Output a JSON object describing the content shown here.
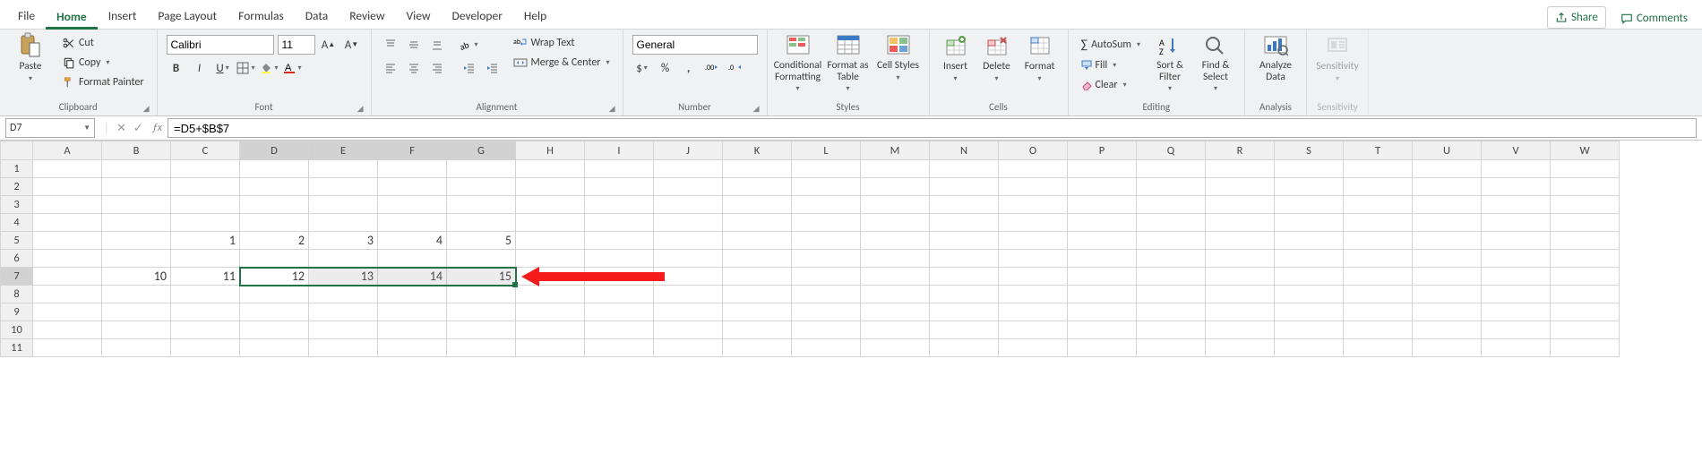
{
  "tabs": {
    "file": "File",
    "home": "Home",
    "insert": "Insert",
    "pagelayout": "Page Layout",
    "formulas": "Formulas",
    "data": "Data",
    "review": "Review",
    "view": "View",
    "developer": "Developer",
    "help": "Help"
  },
  "top_right": {
    "share": "Share",
    "comments": "Comments"
  },
  "ribbon": {
    "clipboard": {
      "paste": "Paste",
      "cut": "Cut",
      "copy": "Copy",
      "fmtpainter": "Format Painter",
      "label": "Clipboard"
    },
    "font": {
      "name": "Calibri",
      "size": "11",
      "label": "Font"
    },
    "alignment": {
      "wrap": "Wrap Text",
      "merge": "Merge & Center",
      "label": "Alignment"
    },
    "number": {
      "fmt": "General",
      "label": "Number"
    },
    "styles": {
      "cond": "Conditional Formatting",
      "tbl": "Format as Table",
      "cell": "Cell Styles",
      "label": "Styles"
    },
    "cells": {
      "insert": "Insert",
      "delete": "Delete",
      "format": "Format",
      "label": "Cells"
    },
    "editing": {
      "sum": "AutoSum",
      "fill": "Fill",
      "clear": "Clear",
      "sort": "Sort & Filter",
      "find": "Find & Select",
      "label": "Editing"
    },
    "analysis": {
      "analyze": "Analyze Data",
      "label": "Analysis"
    },
    "sens": {
      "sens": "Sensitivity",
      "label": "Sensitivity"
    }
  },
  "fx": {
    "cell": "D7",
    "formula": "=D5+$B$7"
  },
  "cols": [
    "A",
    "B",
    "C",
    "D",
    "E",
    "F",
    "G",
    "H",
    "I",
    "J",
    "K",
    "L",
    "M",
    "N",
    "O",
    "P",
    "Q",
    "R",
    "S",
    "T",
    "U",
    "V",
    "W"
  ],
  "rows": [
    "1",
    "2",
    "3",
    "4",
    "5",
    "6",
    "7",
    "8",
    "9",
    "10",
    "11"
  ],
  "cells": {
    "5": {
      "C": "1",
      "D": "2",
      "E": "3",
      "F": "4",
      "G": "5"
    },
    "7": {
      "B": "10",
      "C": "11",
      "D": "12",
      "E": "13",
      "F": "14",
      "G": "15"
    }
  },
  "selection": {
    "sel_cols": [
      "D",
      "E",
      "F",
      "G"
    ],
    "sel_row": "7"
  }
}
